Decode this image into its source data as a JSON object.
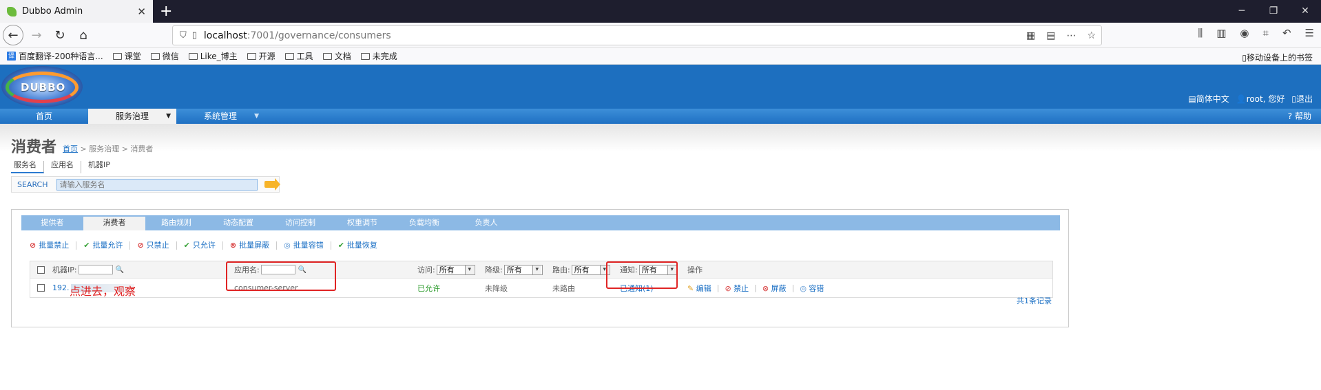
{
  "browser": {
    "tab_title": "Dubbo Admin",
    "tab_close": "✕",
    "new_tab": "+",
    "url_host": "localhost",
    "url_path": ":7001/governance/consumers",
    "bookmarks": [
      "百度翻译-200种语言...",
      "课堂",
      "微信",
      "Like_博主",
      "开源",
      "工具",
      "文档",
      "未完成"
    ],
    "mobile_bookmarks": "移动设备上的书签"
  },
  "header": {
    "logo_text": "DUBBO",
    "lang": "简体中文",
    "user": "root, 您好",
    "logout": "退出"
  },
  "menu": {
    "items": [
      "首页",
      "服务治理",
      "系统管理"
    ],
    "help": "帮助"
  },
  "page": {
    "title": "消费者",
    "breadcrumb_home": "首页",
    "breadcrumb_rest": " > 服务治理 > 消费者",
    "search_tabs": [
      "服务名",
      "应用名",
      "机器IP"
    ],
    "search_label": "SEARCH",
    "search_placeholder": "请输入服务名"
  },
  "panel": {
    "tabs": [
      "提供者",
      "消费者",
      "路由规则",
      "动态配置",
      "访问控制",
      "权重调节",
      "负载均衡",
      "负责人"
    ],
    "active_tab": "消费者",
    "actions": [
      "批量禁止",
      "批量允许",
      "只禁止",
      "只允许",
      "批量屏蔽",
      "批量容错",
      "批量恢复"
    ],
    "headers": {
      "ip": "机器IP:",
      "app": "应用名:",
      "access": "访问:",
      "degrade": "降级:",
      "route": "路由:",
      "notify": "通知:",
      "ops": "操作"
    },
    "filter_value": "所有",
    "row": {
      "ip": "192.",
      "app": "consumer-server",
      "access": "已允许",
      "degrade": "未降级",
      "route": "未路由",
      "notify": "已通知(1)",
      "ops": [
        "编辑",
        "禁止",
        "屏蔽",
        "容错"
      ]
    },
    "total": "共1条记录"
  },
  "annotation": {
    "note": "点进去，观察",
    "color": "#e02424"
  }
}
